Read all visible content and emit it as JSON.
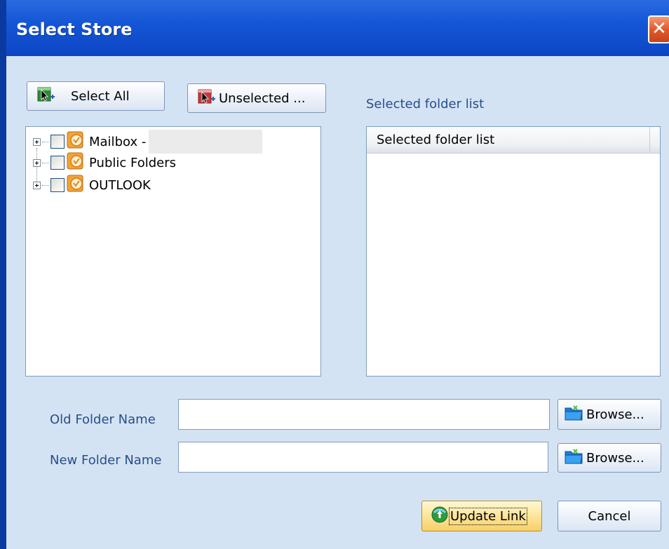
{
  "window": {
    "title": "Select Store",
    "close_label": "✕"
  },
  "toolbar": {
    "select_all_label": "Select All",
    "unselected_label": "Unselected ..."
  },
  "selected_list": {
    "label": "Selected folder list",
    "header": "Selected folder list"
  },
  "tree": {
    "items": [
      {
        "label": "Mailbox -",
        "checked": false
      },
      {
        "label": "Public Folders",
        "checked": false
      },
      {
        "label": "OUTLOOK",
        "checked": false
      }
    ]
  },
  "form": {
    "old_folder_label": "Old Folder Name",
    "old_folder_value": "",
    "new_folder_label": "New Folder Name",
    "new_folder_value": "",
    "browse_label": "Browse..."
  },
  "actions": {
    "update_label": "Update Link",
    "cancel_label": "Cancel"
  },
  "colors": {
    "titlebar": "#1556d6",
    "background": "#d4e3f4",
    "label_blue": "#274e8a",
    "close_button": "#e05a2a"
  },
  "icons": {
    "select_all": "cursor-plus-icon",
    "unselected": "cursor-minus-icon",
    "store": "outlook-store-icon",
    "browse": "folder-open-icon",
    "update": "globe-refresh-icon"
  }
}
